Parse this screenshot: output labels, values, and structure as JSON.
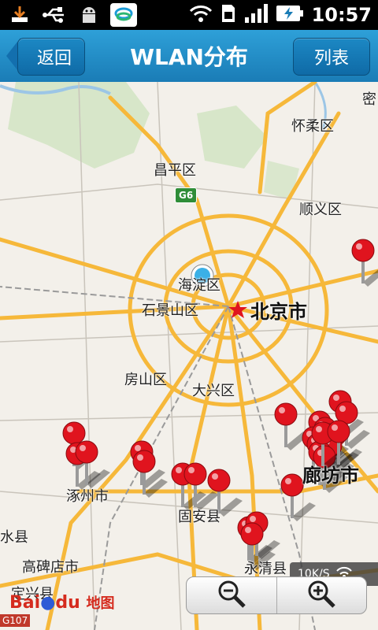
{
  "status_bar": {
    "time": "10:57",
    "icons": [
      "download-icon",
      "usb-icon",
      "android-debug-icon",
      "china-mobile-icon",
      "wifi-icon",
      "sim-icon",
      "signal-icon",
      "battery-charging-icon"
    ]
  },
  "header": {
    "back_label": "返回",
    "title": "WLAN分布",
    "list_label": "列表"
  },
  "map": {
    "labels": {
      "miyun": "密",
      "huairou": "怀柔区",
      "changping": "昌平区",
      "shunyi": "顺义区",
      "haidian": "海淀区",
      "shijingshan": "石景山区",
      "beijing": "北京市",
      "fangshan": "房山区",
      "daxing": "大兴区",
      "zhuozhou": "涿州市",
      "gu_an": "固安县",
      "langfang": "廊坊市",
      "yongqing": "永清县",
      "gaobeidian": "高碑店市",
      "shuixian": "水县",
      "dingxing": "定兴县"
    },
    "highway_label": "G6",
    "road_badge": "G107",
    "pins_count": 27
  },
  "overlay": {
    "speed": "10K/S",
    "zoom_out_icon": "zoom-out-icon",
    "zoom_in_icon": "zoom-in-icon"
  },
  "brand": {
    "baidu_text": "Bai",
    "baidu_du": "du",
    "map_text": "地图"
  },
  "colors": {
    "titlebar": "#1a7cb6",
    "pin": "#e0141e",
    "road": "#f6b83a"
  }
}
